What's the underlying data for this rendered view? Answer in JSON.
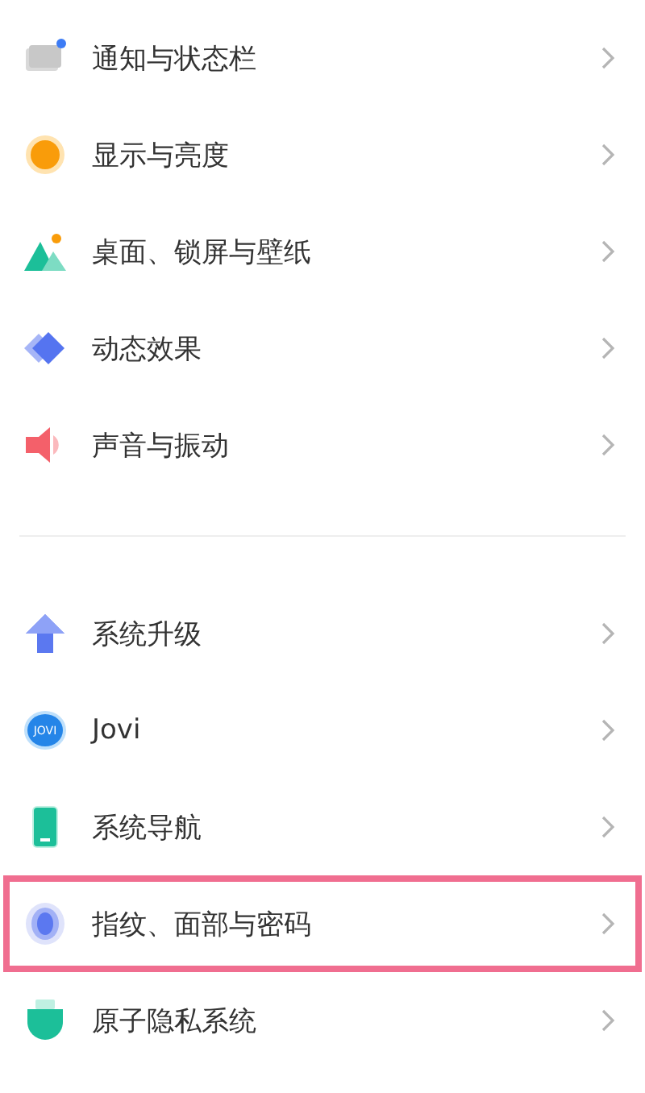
{
  "sections": [
    {
      "items": [
        {
          "label": "通知与状态栏",
          "highlighted": false
        },
        {
          "label": "显示与亮度",
          "highlighted": false
        },
        {
          "label": "桌面、锁屏与壁纸",
          "highlighted": false
        },
        {
          "label": "动态效果",
          "highlighted": false
        },
        {
          "label": "声音与振动",
          "highlighted": false
        }
      ]
    },
    {
      "items": [
        {
          "label": "系统升级",
          "highlighted": false
        },
        {
          "icon_text": "JOVI",
          "label": "Jovi",
          "highlighted": false
        },
        {
          "label": "系统导航",
          "highlighted": false
        },
        {
          "label": "指纹、面部与密码",
          "highlighted": true
        },
        {
          "label": "原子隐私系统",
          "highlighted": false
        }
      ]
    }
  ]
}
